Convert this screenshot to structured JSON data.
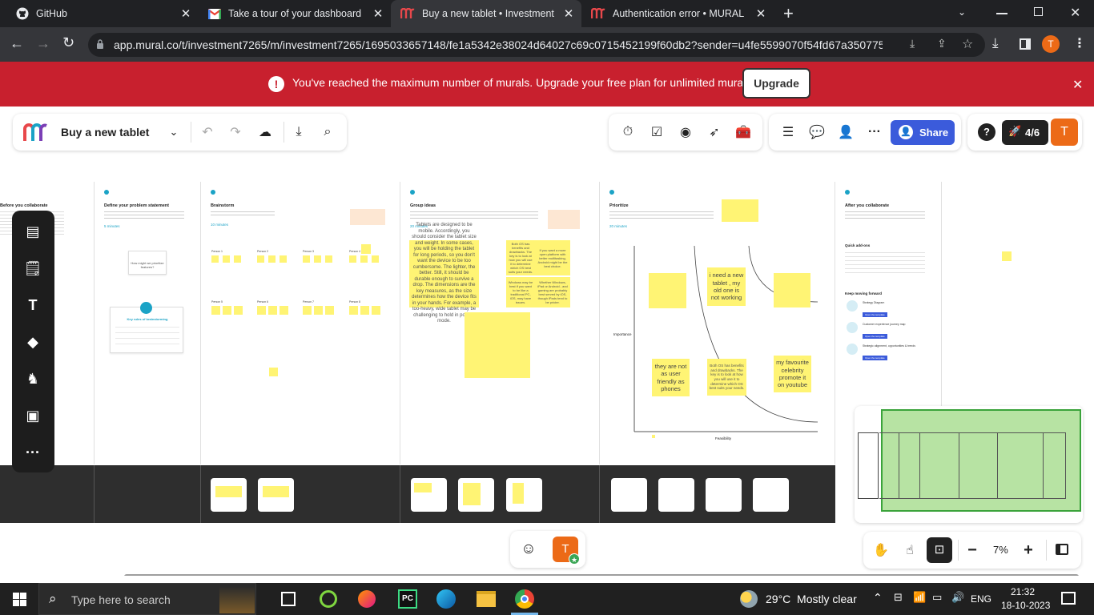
{
  "browser": {
    "tabs": [
      {
        "title": "GitHub",
        "icon": "github-icon"
      },
      {
        "title": "Take a tour of your dashboard - Z",
        "icon": "gmail-icon"
      },
      {
        "title": "Buy a new tablet • Investment",
        "icon": "mural-icon",
        "active": true
      },
      {
        "title": "Authentication error • MURAL",
        "icon": "mural-icon"
      }
    ],
    "url": "app.mural.co/t/investment7265/m/investment7265/1695033657148/fe1a5342e38024d64027c69c0715452199f60db2?sender=u4fe5599070f54fd67a350775",
    "profile_initial": "T"
  },
  "banner": {
    "message": "You've reached the maximum number of murals. Upgrade your free plan for unlimited murals.",
    "button": "Upgrade"
  },
  "toolbar": {
    "mural_title": "Buy a new tablet",
    "share": "Share",
    "progress": "4/6",
    "user_initial": "T"
  },
  "board": {
    "sections": [
      {
        "title": "Before you collaborate"
      },
      {
        "title": "Define your problem statement",
        "time": "5 minutes"
      },
      {
        "title": "Brainstorm",
        "time": "10 minutes"
      },
      {
        "title": "Group ideas",
        "time": "20 minutes"
      },
      {
        "title": "Prioritize",
        "time": "20 minutes"
      },
      {
        "title": "After you collaborate"
      }
    ],
    "problem_card": "How might we prioritize features?",
    "brainstorm_card": "Key rules of brainstorming",
    "persona_labels": [
      "Person 1",
      "Person 2",
      "Person 3",
      "Person 4",
      "Person 5",
      "Person 6",
      "Person 7",
      "Person 8"
    ],
    "group_stickies": [
      "Tablets are designed to be mobile. Accordingly, you should consider the tablet size and weight. In some cases, you will be holding the tablet for long periods, so you don't want the device to be too cumbersome. The lighter, the better. Still, it should be durable enough to survive a drop. The dimensions are the key measures, as the size determines how the device fits in your hands. For example, a too-heavy, wide tablet may be challenging to hold in portrait mode.",
      "Both OS has benefits and drawbacks. The key is to look at how you will use it to determine which OS best suits your needs.",
      "Windows may be best if you want to be like a traditional PC, iOS, may have issues.",
      "If you want a more open platform with better multitasking, Android might be the best choice.",
      "Whether Windows, iPad or Android - and gaming are probably best served by iOS, though iPads tend to be pricier."
    ],
    "prioritize": {
      "y_label": "Importance",
      "x_label": "Feasibility",
      "stickies": [
        "i need a new tablet , my old one is not working",
        "they are not as user friendly as phones",
        "Both OS has benefits and drawbacks. The key is to look at how you will use it to determine which OS best suits your needs.",
        "my favourite celebrity promote it on youtube"
      ]
    },
    "after": {
      "quick_add": "Quick add-ons",
      "keep_moving": "Keep moving forward",
      "templates": [
        "Strategy Diagram",
        "Customer experience journey map",
        "Strategic alignment, opportunities & trends"
      ],
      "template_button": "Open the template"
    }
  },
  "bottom": {
    "zoom": "7%",
    "user_initial": "T"
  },
  "taskbar": {
    "search_placeholder": "Type here to search",
    "weather": "29°C  Mostly clear",
    "language": "ENG",
    "time": "21:32",
    "date": "18-10-2023"
  },
  "colors": {
    "banner": "#c8202e",
    "share": "#3b5bdb",
    "user": "#ec6a17",
    "sticky": "#fff474",
    "minimap": "#b7e3a3",
    "mural_red": "#e8484b"
  }
}
